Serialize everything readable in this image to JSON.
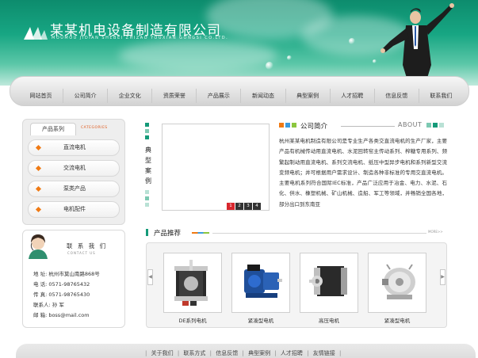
{
  "header": {
    "company_name": "某某机电设备制造有限公司",
    "company_name_en": "MOUMOU JIDIAN SHEBEI ZHIZAO YOUXIAN GONGSI CO.LTD."
  },
  "nav": {
    "items": [
      "网站首页",
      "公司简介",
      "企业文化",
      "资质荣誉",
      "产品展示",
      "新闻动态",
      "典型案例",
      "人才招聘",
      "信息反馈",
      "联系我们"
    ]
  },
  "sidebar": {
    "category_title": "产品系列",
    "category_title_en": "CATEGORIES",
    "categories": [
      "直流电机",
      "交流电机",
      "泵类产品",
      "电机配件"
    ],
    "contact_title": "联 系 我 们",
    "contact_title_en": "CONTACT US",
    "contact_lines": [
      "地  址: 杭州市莫山南路868号",
      "电  话: 0571-98765432",
      "传  真: 0571-98765430",
      "联系人: 孙 军",
      "邮  箱: boss@mail.com"
    ]
  },
  "cases": {
    "title": "典型案例",
    "pages": [
      "1",
      "2",
      "3",
      "4"
    ]
  },
  "about": {
    "title": "公司简介",
    "title_en": "ABOUT",
    "text": "杭州某某电机制造有限公司是专业生产各类交直流电机的生产厂家，主要产品有机械传动用直流电机、水泥回转窑主传动系列、榨糖专用系列、频繁起制动用直流电机、系列交流电机、纸压中型异步电机和系列新型交流变频电机；并可根据用户需求设计、制造各种非标准的专用交直流电机。主要电机系列符合国际IEC标准，产品广泛应用于冶金、电力、水泥、石化、供水、橡塑机械、矿山机械、造船、军工等领域，并畅销全国各地，部分出口到东南亚"
  },
  "recommend": {
    "title": "产品推荐",
    "more": "MORE>>",
    "products": [
      "DE系列电机",
      "紧凑型电机",
      "高压电机",
      "紧凑型电机"
    ]
  },
  "footer": {
    "links": [
      "关于我们",
      "联系方式",
      "信息反馈",
      "典型案例",
      "人才招聘",
      "友情链接"
    ]
  },
  "colors": {
    "brand_green": "#159a79",
    "accent_orange": "#f07a14",
    "pager_active": "#d8262d"
  }
}
